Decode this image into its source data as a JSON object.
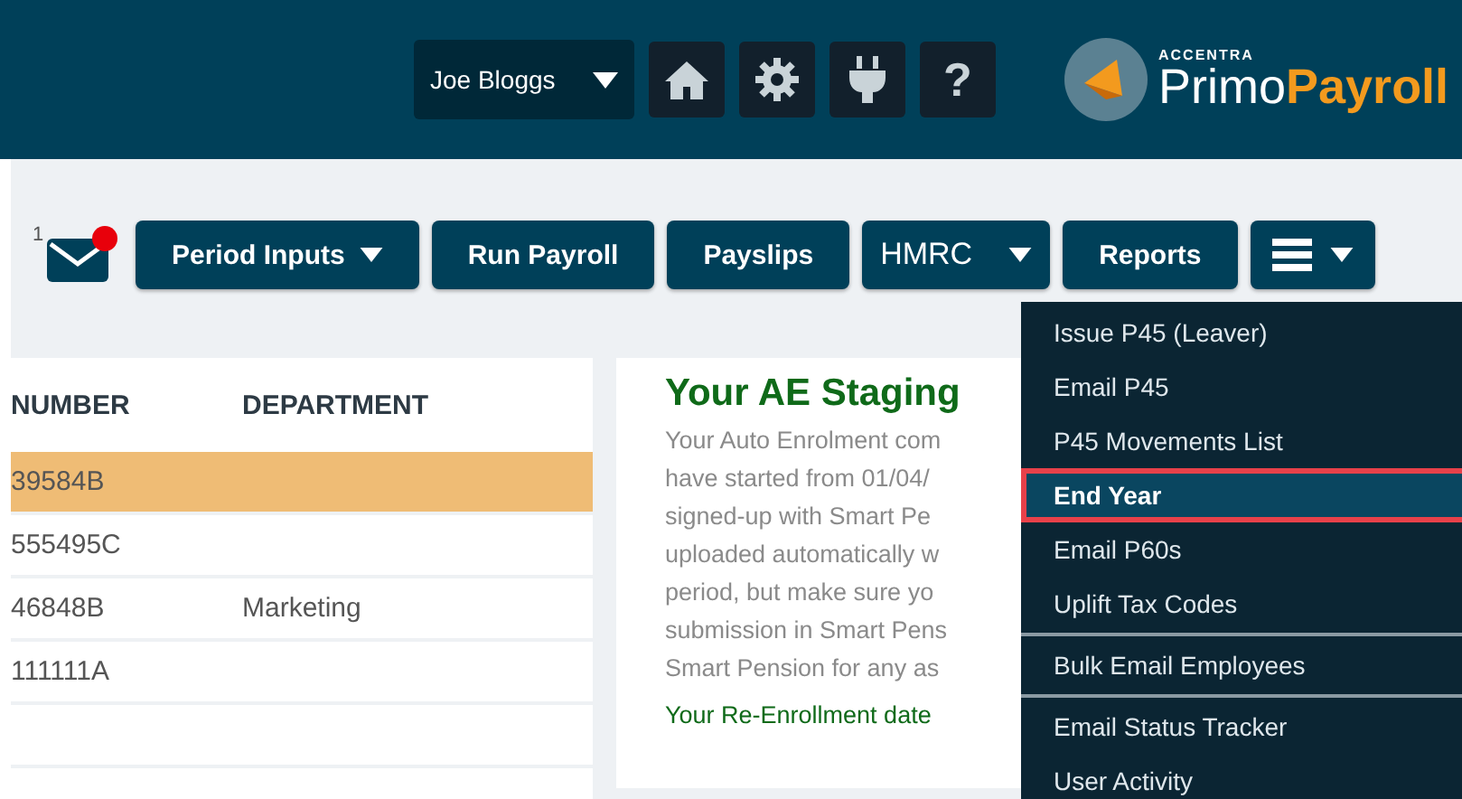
{
  "header": {
    "user": "Joe Bloggs",
    "help": "?",
    "logo": {
      "brand": "ACCENTRA",
      "name_light": "Primo",
      "name_bold": "Payroll"
    }
  },
  "toolbar": {
    "mail_count": "1",
    "mail_unread": true,
    "buttons": [
      {
        "label": "Period Inputs",
        "dropdown": true
      },
      {
        "label": "Run Payroll",
        "dropdown": false
      },
      {
        "label": "Payslips",
        "dropdown": false
      },
      {
        "label": "HMRC",
        "dropdown": true
      },
      {
        "label": "Reports",
        "dropdown": false
      }
    ]
  },
  "table": {
    "columns": [
      "NUMBER",
      "DEPARTMENT"
    ],
    "rows": [
      {
        "cells": [
          "39584B",
          ""
        ],
        "selected": true
      },
      {
        "cells": [
          "555495C",
          ""
        ],
        "selected": false
      },
      {
        "cells": [
          "46848B",
          "Marketing"
        ],
        "selected": false
      },
      {
        "cells": [
          "111111A",
          ""
        ],
        "selected": false
      },
      {
        "cells": [
          "",
          ""
        ],
        "selected": false
      }
    ]
  },
  "ae_panel": {
    "title": "Your AE Staging",
    "body": [
      "Your Auto Enrolment com",
      "have started from 01/04/",
      "signed-up with Smart Pe",
      "uploaded automatically w",
      "period, but make sure yo",
      "submission in Smart Pens",
      "Smart Pension for any as"
    ],
    "footer": "Your Re-Enrollment date"
  },
  "menu": {
    "items": [
      {
        "label": "Issue P45 (Leaver)",
        "selected": false,
        "divider_before": false
      },
      {
        "label": "Email P45",
        "selected": false,
        "divider_before": false
      },
      {
        "label": "P45 Movements List",
        "selected": false,
        "divider_before": false
      },
      {
        "label": "End Year",
        "selected": true,
        "divider_before": false
      },
      {
        "label": "Email P60s",
        "selected": false,
        "divider_before": false
      },
      {
        "label": "Uplift Tax Codes",
        "selected": false,
        "divider_before": false
      },
      {
        "label": "Bulk Email Employees",
        "selected": false,
        "divider_before": true
      },
      {
        "label": "Email Status Tracker",
        "selected": false,
        "divider_before": true
      },
      {
        "label": "User Activity",
        "selected": false,
        "divider_before": false
      }
    ]
  }
}
